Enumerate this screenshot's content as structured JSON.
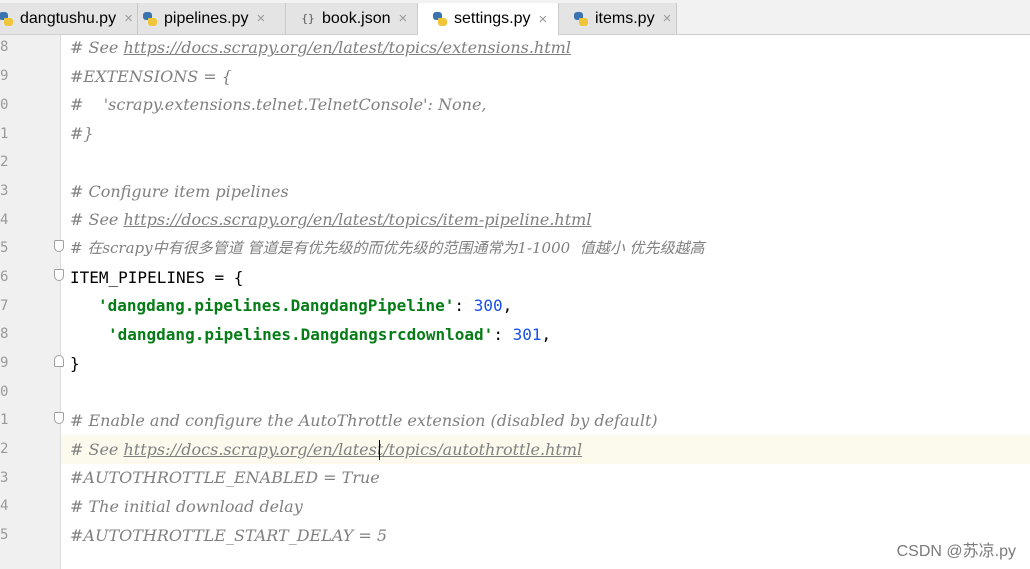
{
  "tabs": [
    {
      "label": "dangtushu.py",
      "icon": "python-file-icon",
      "active": false
    },
    {
      "label": "pipelines.py",
      "icon": "python-file-icon",
      "active": false
    },
    {
      "label": "book.json",
      "icon": "json-file-icon",
      "active": false
    },
    {
      "label": "settings.py",
      "icon": "python-file-icon",
      "active": true
    },
    {
      "label": "items.py",
      "icon": "python-file-icon",
      "active": false
    }
  ],
  "tab_close": "×",
  "json_icon_text": "{}",
  "gutter": {
    "line_numbers": [
      "8",
      "9",
      "0",
      "1",
      "2",
      "3",
      "4",
      "5",
      "6",
      "7",
      "8",
      "9",
      "0",
      "1",
      "2",
      "3",
      "4",
      "5"
    ]
  },
  "code": {
    "l1_prefix": "# See ",
    "l1_url": "https://docs.scrapy.org/en/latest/topics/extensions.html",
    "l2": "#EXTENSIONS = {",
    "l3": "#    'scrapy.extensions.telnet.TelnetConsole': None,",
    "l4": "#}",
    "l5": "",
    "l6": "# Configure item pipelines",
    "l7_prefix": "# See ",
    "l7_url": "https://docs.scrapy.org/en/latest/topics/item-pipeline.html",
    "l8": "# 在scrapy中有很多管道 管道是有优先级的而优先级的范围通常为1-1000  值越小 优先级越高",
    "l9": "ITEM_PIPELINES = {",
    "l10_str": "'dangdang.pipelines.DangdangPipeline'",
    "l10_sep": ": ",
    "l10_num": "300",
    "l10_end": ",",
    "l11_str": "'dangdang.pipelines.Dangdangsrcdownload'",
    "l11_sep": ": ",
    "l11_num": "301",
    "l11_end": ",",
    "l12": "}",
    "l13": "",
    "l14": "# Enable and configure the AutoThrottle extension (disabled by default)",
    "l15_prefix": "# See ",
    "l15_url": "https://docs.scrapy.org/en/latest/topics/autothrottle.html",
    "l16": "#AUTOTHROTTLE_ENABLED = True",
    "l17": "# The initial download delay",
    "l18": "#AUTOTHROTTLE_START_DELAY = 5"
  },
  "watermark": "CSDN @苏凉.py",
  "colors": {
    "comment": "#808080",
    "string": "#067d17",
    "number": "#1750eb",
    "current_line": "#fcfaed"
  }
}
